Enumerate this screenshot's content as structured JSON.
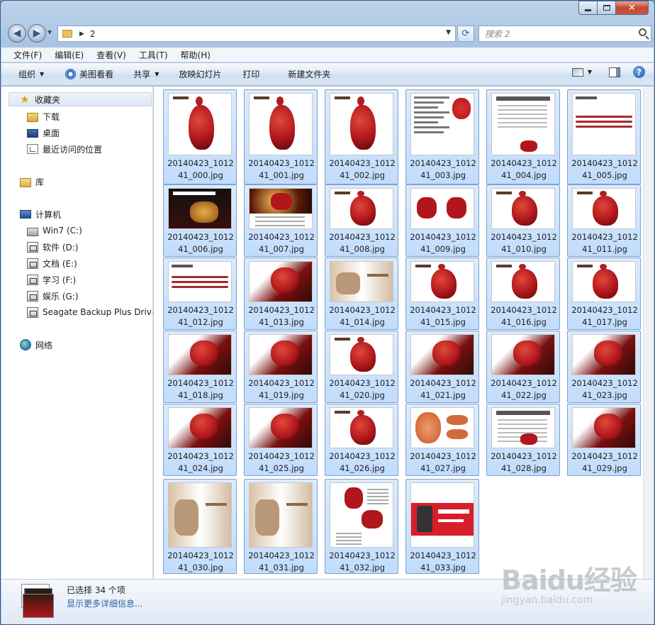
{
  "window": {
    "caption_min": "",
    "caption_max": "",
    "caption_close": "✕"
  },
  "address": {
    "crumb": "2",
    "search_placeholder": "搜索 2"
  },
  "menu": [
    "文件(F)",
    "编辑(E)",
    "查看(V)",
    "工具(T)",
    "帮助(H)"
  ],
  "toolbar": {
    "organize": "组织",
    "meitu": "美图看看",
    "share": "共享",
    "slideshow": "放映幻灯片",
    "print": "打印",
    "new_folder": "新建文件夹",
    "help": "?"
  },
  "nav": {
    "favorites": "收藏夹",
    "downloads": "下载",
    "desktop": "桌面",
    "recent": "最近访问的位置",
    "libraries": "库",
    "computer": "计算机",
    "drive_c": "Win7 (C:)",
    "drive_d": "软件 (D:)",
    "drive_e": "文档 (E:)",
    "drive_f": "学习 (F:)",
    "drive_g": "娱乐 (G:)",
    "drive_seagate": "Seagate Backup Plus Drive",
    "network": "网络"
  },
  "files": [
    {
      "l1": "20140423_1012",
      "l2": "41_000.jpg",
      "kind": "pixiu"
    },
    {
      "l1": "20140423_1012",
      "l2": "41_001.jpg",
      "kind": "pixiu"
    },
    {
      "l1": "20140423_1012",
      "l2": "41_002.jpg",
      "kind": "pixiu"
    },
    {
      "l1": "20140423_1012",
      "l2": "41_003.jpg",
      "kind": "text"
    },
    {
      "l1": "20140423_1012",
      "l2": "41_004.jpg",
      "kind": "doc"
    },
    {
      "l1": "20140423_1012",
      "l2": "41_005.jpg",
      "kind": "strings"
    },
    {
      "l1": "20140423_1012",
      "l2": "41_006.jpg",
      "kind": "banner"
    },
    {
      "l1": "20140423_1012",
      "l2": "41_007.jpg",
      "kind": "dark"
    },
    {
      "l1": "20140423_1012",
      "l2": "41_008.jpg",
      "kind": "pixiu"
    },
    {
      "l1": "20140423_1012",
      "l2": "41_009.jpg",
      "kind": "two"
    },
    {
      "l1": "20140423_1012",
      "l2": "41_010.jpg",
      "kind": "pixiu"
    },
    {
      "l1": "20140423_1012",
      "l2": "41_011.jpg",
      "kind": "pixiu"
    },
    {
      "l1": "20140423_1012",
      "l2": "41_012.jpg",
      "kind": "strings"
    },
    {
      "l1": "20140423_1012",
      "l2": "41_013.jpg",
      "kind": "red"
    },
    {
      "l1": "20140423_1012",
      "l2": "41_014.jpg",
      "kind": "photo"
    },
    {
      "l1": "20140423_1012",
      "l2": "41_015.jpg",
      "kind": "pixiu"
    },
    {
      "l1": "20140423_1012",
      "l2": "41_016.jpg",
      "kind": "pixiu"
    },
    {
      "l1": "20140423_1012",
      "l2": "41_017.jpg",
      "kind": "pixiu"
    },
    {
      "l1": "20140423_1012",
      "l2": "41_018.jpg",
      "kind": "red"
    },
    {
      "l1": "20140423_1012",
      "l2": "41_019.jpg",
      "kind": "red"
    },
    {
      "l1": "20140423_1012",
      "l2": "41_020.jpg",
      "kind": "pixiu"
    },
    {
      "l1": "20140423_1012",
      "l2": "41_021.jpg",
      "kind": "red"
    },
    {
      "l1": "20140423_1012",
      "l2": "41_022.jpg",
      "kind": "red"
    },
    {
      "l1": "20140423_1012",
      "l2": "41_023.jpg",
      "kind": "red"
    },
    {
      "l1": "20140423_1012",
      "l2": "41_024.jpg",
      "kind": "red"
    },
    {
      "l1": "20140423_1012",
      "l2": "41_025.jpg",
      "kind": "red"
    },
    {
      "l1": "20140423_1012",
      "l2": "41_026.jpg",
      "kind": "pixiu"
    },
    {
      "l1": "20140423_1012",
      "l2": "41_027.jpg",
      "kind": "orange"
    },
    {
      "l1": "20140423_1012",
      "l2": "41_028.jpg",
      "kind": "doc"
    },
    {
      "l1": "20140423_1012",
      "l2": "41_029.jpg",
      "kind": "red"
    },
    {
      "l1": "20140423_1012",
      "l2": "41_030.jpg",
      "kind": "photo"
    },
    {
      "l1": "20140423_1012",
      "l2": "41_031.jpg",
      "kind": "photo"
    },
    {
      "l1": "20140423_1012",
      "l2": "41_032.jpg",
      "kind": "tall"
    },
    {
      "l1": "20140423_1012",
      "l2": "41_033.jpg",
      "kind": "tmall"
    }
  ],
  "details": {
    "selected": "已选择 34 个项",
    "more": "显示更多详细信息..."
  },
  "watermark": {
    "logo": "Baidu经验",
    "url": "jingyan.baidu.com"
  },
  "colors": {
    "selection_fill": "#c1dcfc",
    "selection_border": "#7da2ce",
    "jade_red": "#b0161b"
  }
}
